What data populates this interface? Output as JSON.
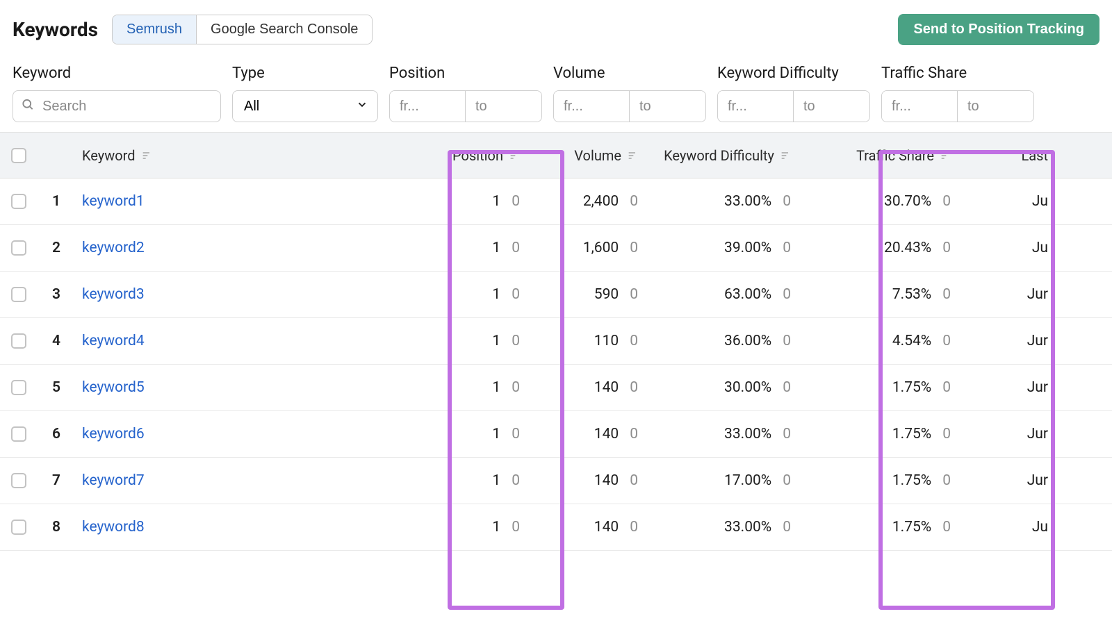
{
  "header": {
    "title": "Keywords",
    "tabs": [
      "Semrush",
      "Google Search Console"
    ],
    "active_tab": 0,
    "send_button": "Send to Position Tracking"
  },
  "filters": {
    "keyword": {
      "label": "Keyword",
      "placeholder": "Search"
    },
    "type": {
      "label": "Type",
      "selected": "All"
    },
    "position": {
      "label": "Position",
      "from": "fr...",
      "to": "to"
    },
    "volume": {
      "label": "Volume",
      "from": "fr...",
      "to": "to"
    },
    "difficulty": {
      "label": "Keyword Difficulty",
      "from": "fr...",
      "to": "to"
    },
    "traffic_share": {
      "label": "Traffic Share",
      "from": "fr...",
      "to": "to"
    }
  },
  "columns": {
    "keyword": "Keyword",
    "position": "Position",
    "volume": "Volume",
    "difficulty": "Keyword Difficulty",
    "traffic_share": "Traffic Share",
    "last": "Last"
  },
  "rows": [
    {
      "idx": "1",
      "keyword": "keyword1",
      "position": "1",
      "pos_delta": "0",
      "volume": "2,400",
      "vol_delta": "0",
      "difficulty": "33.00%",
      "diff_delta": "0",
      "traffic_share": "30.70%",
      "ts_delta": "0",
      "last": "Ju"
    },
    {
      "idx": "2",
      "keyword": "keyword2",
      "position": "1",
      "pos_delta": "0",
      "volume": "1,600",
      "vol_delta": "0",
      "difficulty": "39.00%",
      "diff_delta": "0",
      "traffic_share": "20.43%",
      "ts_delta": "0",
      "last": "Ju"
    },
    {
      "idx": "3",
      "keyword": "keyword3",
      "position": "1",
      "pos_delta": "0",
      "volume": "590",
      "vol_delta": "0",
      "difficulty": "63.00%",
      "diff_delta": "0",
      "traffic_share": "7.53%",
      "ts_delta": "0",
      "last": "Jur"
    },
    {
      "idx": "4",
      "keyword": "keyword4",
      "position": "1",
      "pos_delta": "0",
      "volume": "110",
      "vol_delta": "0",
      "difficulty": "36.00%",
      "diff_delta": "0",
      "traffic_share": "4.54%",
      "ts_delta": "0",
      "last": "Jur"
    },
    {
      "idx": "5",
      "keyword": "keyword5",
      "position": "1",
      "pos_delta": "0",
      "volume": "140",
      "vol_delta": "0",
      "difficulty": "30.00%",
      "diff_delta": "0",
      "traffic_share": "1.75%",
      "ts_delta": "0",
      "last": "Jur"
    },
    {
      "idx": "6",
      "keyword": "keyword6",
      "position": "1",
      "pos_delta": "0",
      "volume": "140",
      "vol_delta": "0",
      "difficulty": "33.00%",
      "diff_delta": "0",
      "traffic_share": "1.75%",
      "ts_delta": "0",
      "last": "Jur"
    },
    {
      "idx": "7",
      "keyword": "keyword7",
      "position": "1",
      "pos_delta": "0",
      "volume": "140",
      "vol_delta": "0",
      "difficulty": "17.00%",
      "diff_delta": "0",
      "traffic_share": "1.75%",
      "ts_delta": "0",
      "last": "Jur"
    },
    {
      "idx": "8",
      "keyword": "keyword8",
      "position": "1",
      "pos_delta": "0",
      "volume": "140",
      "vol_delta": "0",
      "difficulty": "33.00%",
      "diff_delta": "0",
      "traffic_share": "1.75%",
      "ts_delta": "0",
      "last": "Ju"
    }
  ],
  "colors": {
    "accent_green": "#4aa284",
    "link_blue": "#2563cc",
    "highlight_purple": "#c06fe3"
  }
}
